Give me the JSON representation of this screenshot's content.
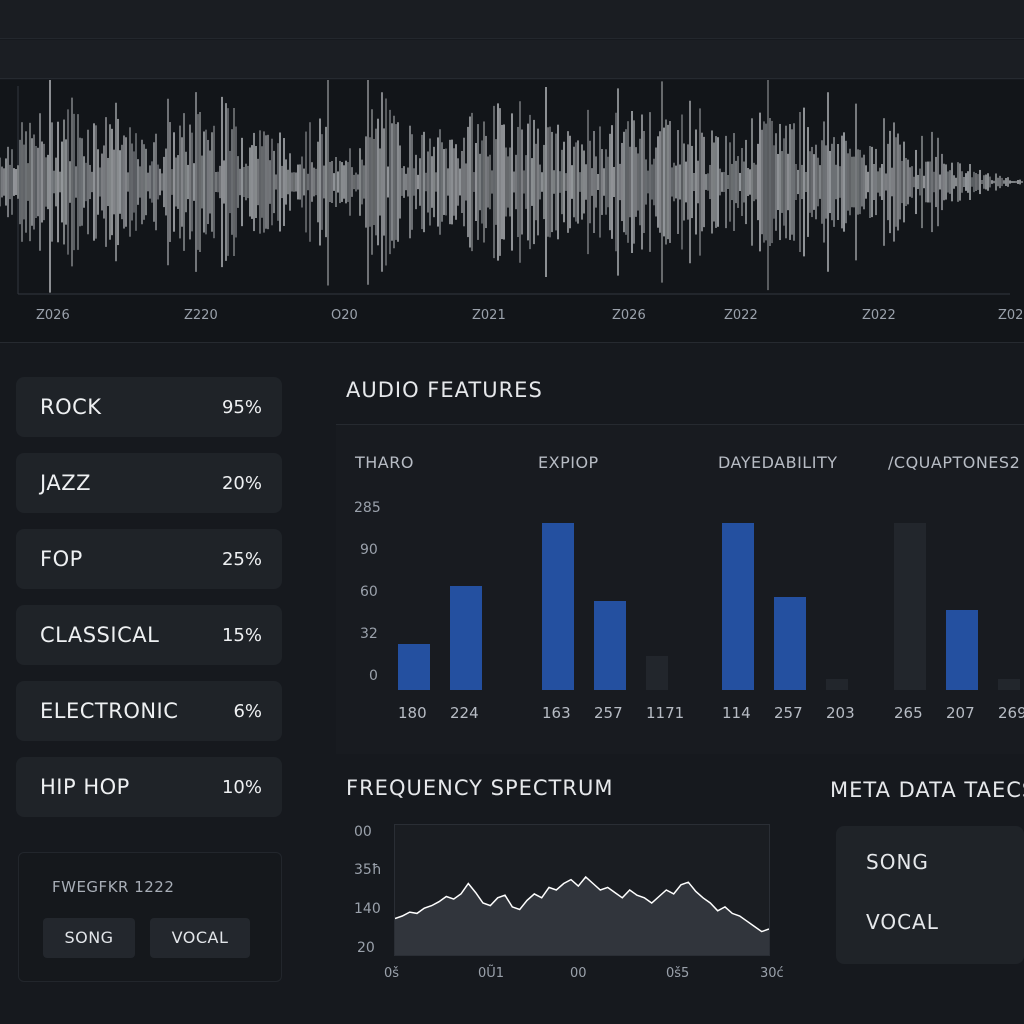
{
  "waveform": {
    "time_labels": [
      "Z026",
      "Z220",
      "O20",
      "Z021",
      "Z026",
      "Z022",
      "Z022",
      "Z02"
    ]
  },
  "genres": [
    {
      "name": "ROCK",
      "percent": "95%"
    },
    {
      "name": "JAZZ",
      "percent": "20%"
    },
    {
      "name": "FOP",
      "percent": "25%"
    },
    {
      "name": "CLASSICAL",
      "percent": "15%"
    },
    {
      "name": "ELECTRONIC",
      "percent": "6%"
    },
    {
      "name": "HIP HOP",
      "percent": "10%"
    }
  ],
  "metadata_card": {
    "title": "FWEGFKR 1222",
    "buttons": [
      "SONG",
      "VOCAL"
    ]
  },
  "audio_features": {
    "title": "AUDIO FEATURES",
    "groups": [
      "THARO",
      "EXPIOP",
      "DAYEDABILITY",
      "/CQUAPTONES2"
    ],
    "y_ticks": [
      "285",
      "90",
      "60",
      "32",
      "0"
    ],
    "x_ticks": [
      "180",
      "224",
      "163",
      "257",
      "1171",
      "114",
      "257",
      "203",
      "265",
      "207",
      "269"
    ]
  },
  "frequency_spectrum": {
    "title": "FREQUENCY SPECTRUM",
    "y_ticks": [
      "00",
      "35ħ",
      "140",
      "20"
    ],
    "x_ticks": [
      "0š",
      "0Ũ1",
      "00",
      "0š5",
      "30ć"
    ]
  },
  "metadata_tags": {
    "title": "META DATA TAECS",
    "tags": [
      "SONG",
      "VOCAL"
    ]
  },
  "chart_data": [
    {
      "type": "bar",
      "title": "AUDIO FEATURES",
      "groups": [
        "THARO",
        "EXPIOP",
        "DAYEDABILITY",
        "/CQUAPTONES2"
      ],
      "y_tick_labels": [
        "285",
        "90",
        "60",
        "32",
        "0"
      ],
      "series": [
        {
          "values": [
            [
              24,
              55
            ],
            [
              88,
              47,
              18
            ],
            [
              88,
              49,
              6
            ],
            [
              88,
              42,
              6
            ]
          ]
        }
      ],
      "highlighted": [
        [
          true,
          true
        ],
        [
          true,
          true,
          false
        ],
        [
          true,
          true,
          false
        ],
        [
          false,
          true,
          false
        ]
      ],
      "x_tick_labels": [
        "180",
        "224",
        "163",
        "257",
        "1171",
        "114",
        "257",
        "203",
        "265",
        "207",
        "269"
      ],
      "ylim": [
        0,
        100
      ]
    },
    {
      "type": "area",
      "title": "FREQUENCY SPECTRUM",
      "y_tick_labels": [
        "00",
        "35ħ",
        "140",
        "20"
      ],
      "x_tick_labels": [
        "0š",
        "0Ũ1",
        "00",
        "0š5",
        "30ć"
      ],
      "values": [
        28,
        30,
        33,
        32,
        36,
        38,
        41,
        45,
        43,
        47,
        55,
        48,
        40,
        38,
        44,
        46,
        37,
        35,
        42,
        47,
        44,
        52,
        50,
        55,
        58,
        53,
        60,
        55,
        50,
        52,
        48,
        44,
        50,
        46,
        44,
        40,
        45,
        50,
        47,
        54,
        56,
        49,
        44,
        40,
        34,
        37,
        32,
        30,
        26,
        22,
        18,
        20
      ],
      "ylim": [
        0,
        100
      ],
      "color": "#ffffff"
    }
  ],
  "colors": {
    "background": "#16191e",
    "panel": "#1f2328",
    "accent": "#2450a0",
    "text": "#e6e8eb"
  }
}
